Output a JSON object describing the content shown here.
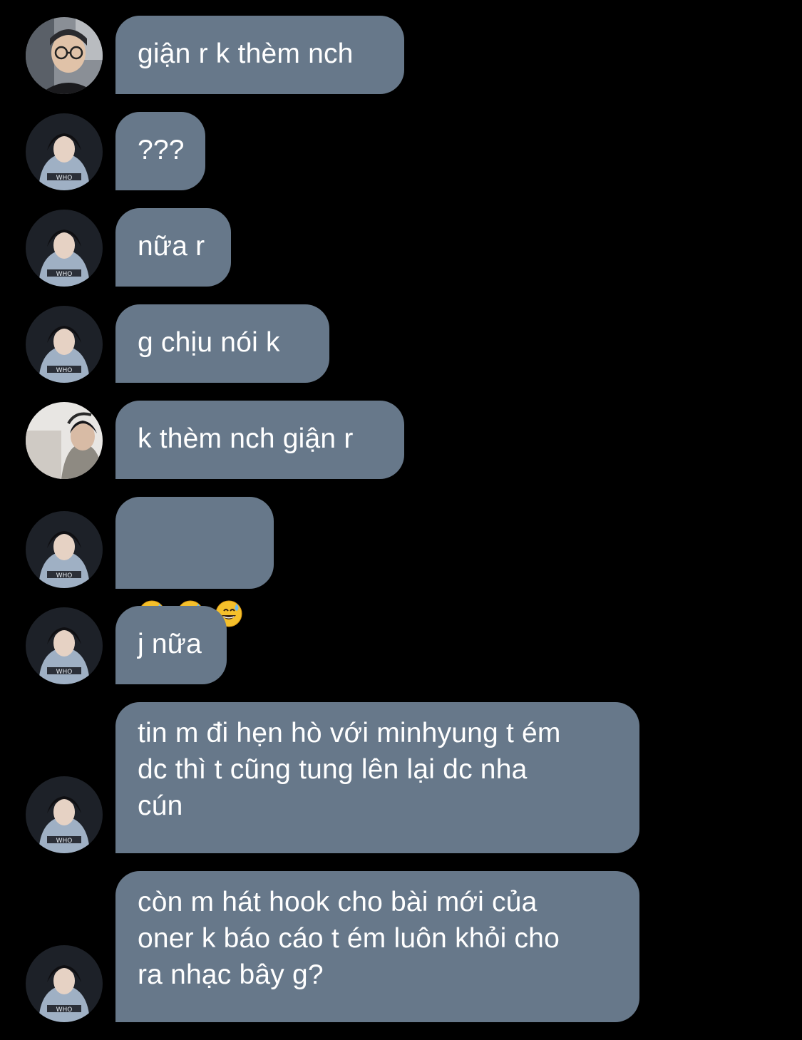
{
  "conversation": {
    "messages": [
      {
        "sender": "avatar-a",
        "text": "giận r k thèm nch"
      },
      {
        "sender": "avatar-b",
        "text": "???"
      },
      {
        "sender": "avatar-b",
        "text": "nữa r"
      },
      {
        "sender": "avatar-b",
        "text": "g chịu nói k"
      },
      {
        "sender": "avatar-c",
        "text": "k thèm nch giận r"
      },
      {
        "sender": "avatar-b",
        "emoji": [
          "grinning-sweat-emoji",
          "grinning-sweat-emoji",
          "grinning-sweat-emoji"
        ]
      },
      {
        "sender": "avatar-b",
        "text": "j nữa"
      },
      {
        "sender": "avatar-b",
        "text": "tin m đi hẹn hò với minhyung t ém\ndc thì t cũng tung lên lại dc nha\ncún"
      },
      {
        "sender": "avatar-b",
        "text": "còn m hát hook cho bài mới của\noner k báo cáo t ém luôn khỏi cho\nra nhạc bây g?"
      }
    ]
  },
  "colors": {
    "background": "#000000",
    "bubble": "#67788a",
    "text": "#ffffff"
  }
}
